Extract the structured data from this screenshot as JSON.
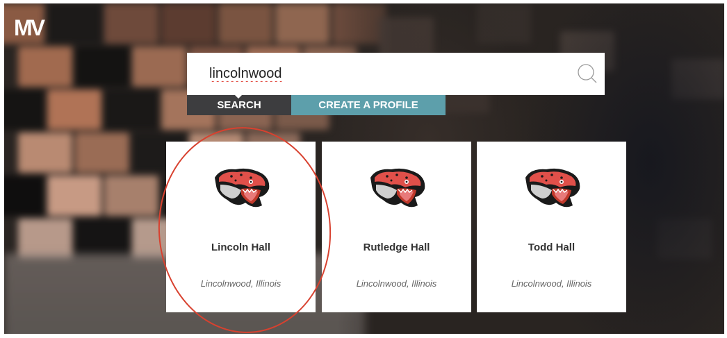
{
  "app": {
    "logo_text": "MV"
  },
  "search": {
    "value": "lincolnwood",
    "icon": "search-icon"
  },
  "tabs": {
    "search_label": "SEARCH",
    "create_label": "CREATE A PROFILE"
  },
  "results": [
    {
      "name": "Lincoln Hall",
      "location": "Lincolnwood, Illinois",
      "icon": "jaguar-mascot-icon"
    },
    {
      "name": "Rutledge Hall",
      "location": "Lincolnwood, Illinois",
      "icon": "jaguar-mascot-icon"
    },
    {
      "name": "Todd Hall",
      "location": "Lincolnwood, Illinois",
      "icon": "jaguar-mascot-icon"
    }
  ],
  "colors": {
    "search_tab": "#3d3d3f",
    "create_tab": "#5d9fab",
    "annotation": "#d8412f",
    "mascot_red": "#e0504a"
  }
}
